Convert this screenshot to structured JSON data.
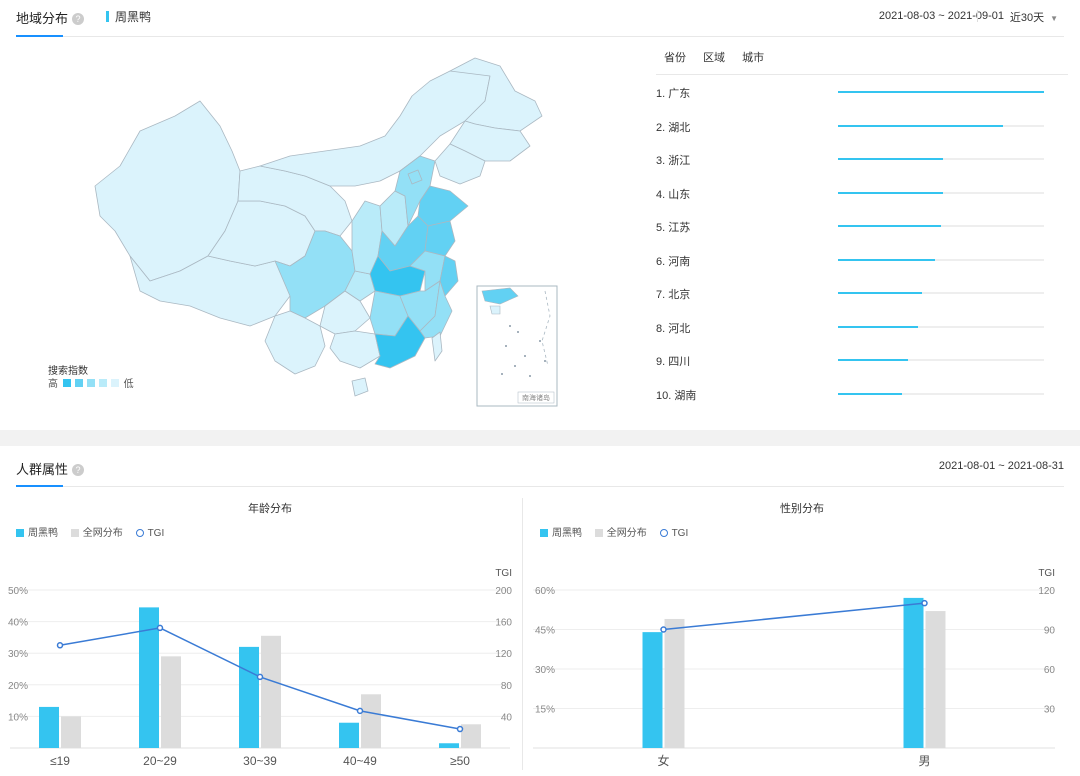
{
  "region": {
    "tab_label": "地域分布",
    "help_icon": "?",
    "keyword": "周黑鸭",
    "date_range": "2021-08-03 ~ 2021-09-01",
    "range_select": "近30天",
    "map_legend": {
      "title": "搜索指数",
      "high": "高",
      "low": "低",
      "colors": [
        "#34c4f0",
        "#62d1f3",
        "#93e0f6",
        "#b9ebf9",
        "#dbf3fc"
      ]
    },
    "inset_label": "南海诸岛",
    "rank_tabs": [
      "省份",
      "区域",
      "城市"
    ],
    "rankings": [
      {
        "label": "1.  广东",
        "value": 100
      },
      {
        "label": "2.  湖北",
        "value": 80
      },
      {
        "label": "3.  浙江",
        "value": 51
      },
      {
        "label": "4.  山东",
        "value": 51
      },
      {
        "label": "5.  江苏",
        "value": 50
      },
      {
        "label": "6.  河南",
        "value": 47
      },
      {
        "label": "7.  北京",
        "value": 41
      },
      {
        "label": "8.  河北",
        "value": 39
      },
      {
        "label": "9.  四川",
        "value": 34
      },
      {
        "label": "10. 湖南",
        "value": 31
      }
    ]
  },
  "crowd": {
    "tab_label": "人群属性",
    "help_icon": "?",
    "date_range": "2021-08-01 ~ 2021-08-31",
    "legend": {
      "brand": "周黑鸭",
      "all": "全网分布",
      "tgi": "TGI"
    }
  },
  "colors": {
    "brand": "#34c4f0",
    "all": "#dcdcdc",
    "tgi": "#3a7bd5",
    "accent": "#1890ff"
  },
  "chart_data": [
    {
      "type": "bar",
      "title": "年龄分布",
      "categories": [
        "≤19",
        "20~29",
        "30~39",
        "40~49",
        "≥50"
      ],
      "series": [
        {
          "name": "周黑鸭",
          "values": [
            13,
            44.5,
            32,
            8,
            1.5
          ]
        },
        {
          "name": "全网分布",
          "values": [
            10,
            29,
            35.5,
            17,
            7.5
          ]
        },
        {
          "name": "TGI",
          "axis": "right",
          "type": "line",
          "values": [
            130,
            152,
            90,
            47,
            24
          ]
        }
      ],
      "yticks": [
        "10%",
        "20%",
        "30%",
        "40%",
        "50%"
      ],
      "ylim": [
        0,
        50
      ],
      "y2label": "TGI",
      "y2ticks": [
        "40",
        "80",
        "120",
        "160",
        "200"
      ],
      "y2lim": [
        0,
        200
      ]
    },
    {
      "type": "bar",
      "title": "性别分布",
      "categories": [
        "女",
        "男"
      ],
      "series": [
        {
          "name": "周黑鸭",
          "values": [
            44,
            57
          ]
        },
        {
          "name": "全网分布",
          "values": [
            49,
            52
          ]
        },
        {
          "name": "TGI",
          "axis": "right",
          "type": "line",
          "values": [
            90,
            110
          ]
        }
      ],
      "yticks": [
        "15%",
        "30%",
        "45%",
        "60%"
      ],
      "ylim": [
        0,
        60
      ],
      "y2label": "TGI",
      "y2ticks": [
        "30",
        "60",
        "90",
        "120"
      ],
      "y2lim": [
        0,
        120
      ]
    }
  ]
}
